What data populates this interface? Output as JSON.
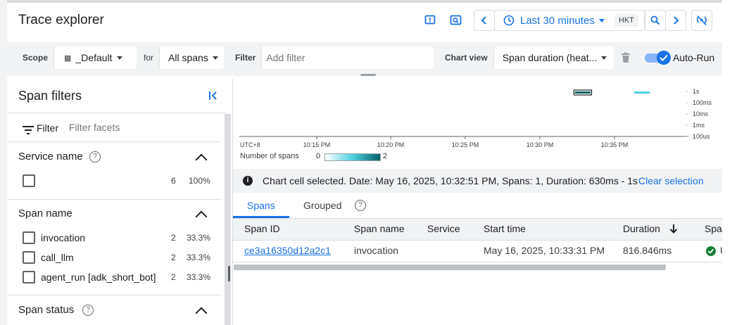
{
  "header": {
    "title": "Trace explorer",
    "time_range": "Last 30 minutes",
    "timezone": "HKT"
  },
  "filterbar": {
    "scope_label": "Scope",
    "scope_value": "_Default",
    "for_label": "for",
    "for_value": "All spans",
    "filter_label": "Filter",
    "filter_placeholder": "Add filter",
    "chartview_label": "Chart view",
    "chartview_value": "Span duration (heat...",
    "autorun_label": "Auto-Run"
  },
  "sidebar": {
    "title": "Span filters",
    "filter_label": "Filter",
    "filter_placeholder": "Filter facets",
    "sections": [
      {
        "title": "Service name",
        "rows": [
          {
            "label": "",
            "count": "6",
            "pct": "100%"
          }
        ]
      },
      {
        "title": "Span name",
        "rows": [
          {
            "label": "invocation",
            "count": "2",
            "pct": "33.3%"
          },
          {
            "label": "call_llm",
            "count": "2",
            "pct": "33.3%"
          },
          {
            "label": "agent_run [adk_short_bot]",
            "count": "2",
            "pct": "33.3%"
          }
        ]
      },
      {
        "title": "Span status",
        "rows": []
      }
    ]
  },
  "chart": {
    "tz_label": "UTC+8",
    "x_ticks": [
      "10:15 PM",
      "10:20 PM",
      "10:25 PM",
      "10:30 PM",
      "10:35 PM"
    ],
    "y_ticks": [
      "1s",
      "100ms",
      "10ms",
      "1ms",
      "100us"
    ],
    "legend_label": "Number of spans",
    "legend_min": "0",
    "legend_max": "2"
  },
  "chart_data": {
    "type": "heatmap",
    "xlabel": "",
    "ylabel": "",
    "x_ticks": [
      "10:15 PM",
      "10:20 PM",
      "10:25 PM",
      "10:30 PM",
      "10:35 PM"
    ],
    "y_ticks": [
      "1s",
      "100ms",
      "10ms",
      "1ms",
      "100us"
    ],
    "color_scale": {
      "label": "Number of spans",
      "min": 0,
      "max": 2
    },
    "cells": [
      {
        "time": "10:33 PM",
        "duration_range": "630ms - 1s",
        "count": 2
      },
      {
        "time": "10:37 PM",
        "duration_range": "630ms - 1s",
        "count": 1
      }
    ]
  },
  "selection": {
    "message": "Chart cell selected. Date: May 16, 2025, 10:32:51 PM, Spans: 1, Duration: 630ms - 1s",
    "clear_label": "Clear selection"
  },
  "results": {
    "tabs": [
      "Spans",
      "Grouped"
    ],
    "columns": [
      "Span ID",
      "Span name",
      "Service",
      "Start time",
      "Duration",
      "Spa"
    ],
    "rows": [
      {
        "span_id": "ce3a16350d12a2c1",
        "span_name": "invocation",
        "service": "",
        "start_time": "May 16, 2025, 10:33:31 PM",
        "duration": "816.846ms",
        "status": "U"
      }
    ]
  },
  "colors": {
    "accent": "#1a73e8",
    "heat_dark": "#006064",
    "heat_light": "#4dd0e1",
    "success": "#188038"
  }
}
